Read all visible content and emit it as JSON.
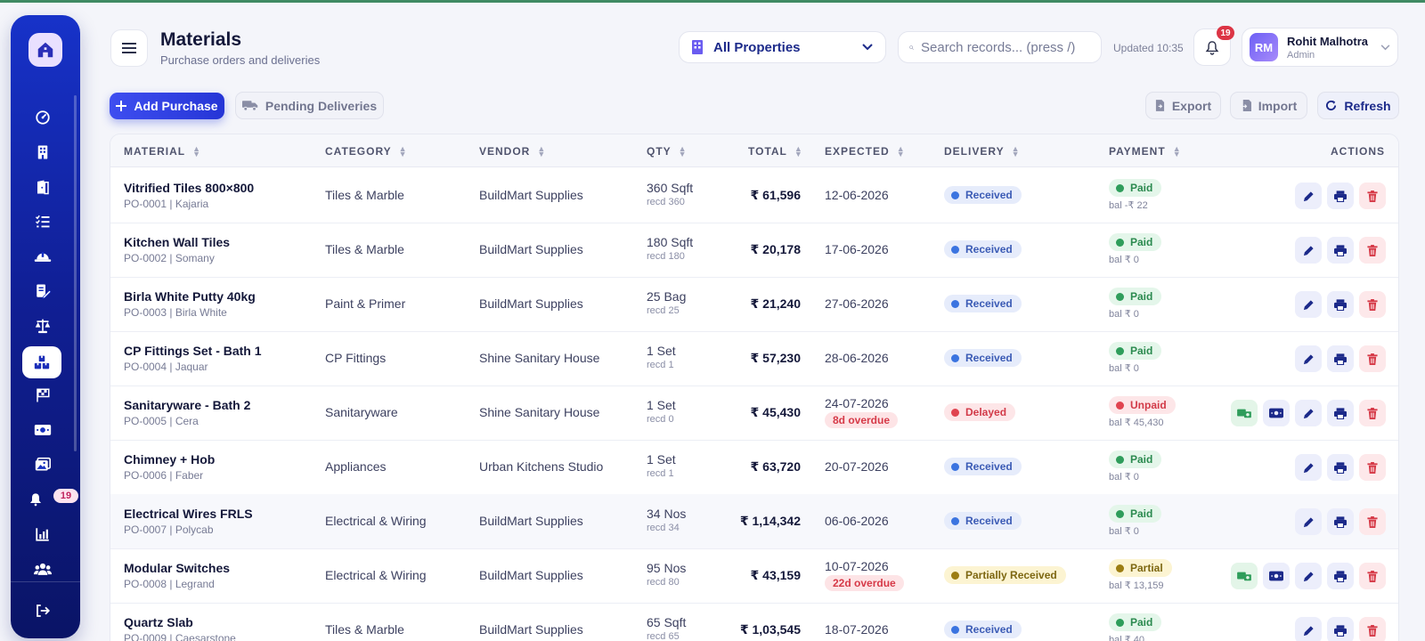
{
  "header": {
    "title": "Materials",
    "subtitle": "Purchase orders and deliveries",
    "property_select": "All Properties",
    "search_placeholder": "Search records... (press /)",
    "updated": "Updated 10:35",
    "notification_count": "19",
    "user": {
      "initials": "RM",
      "name": "Rohit Malhotra",
      "role": "Admin"
    }
  },
  "sidebar": {
    "notification_badge": "19"
  },
  "toolbar": {
    "add_purchase": "Add Purchase",
    "pending_deliveries": "Pending Deliveries",
    "export": "Export",
    "import": "Import",
    "refresh": "Refresh"
  },
  "table": {
    "columns": {
      "material": "MATERIAL",
      "category": "CATEGORY",
      "vendor": "VENDOR",
      "qty": "QTY",
      "total": "TOTAL",
      "expected": "EXPECTED",
      "delivery": "DELIVERY",
      "payment": "PAYMENT",
      "actions": "ACTIONS"
    },
    "rows": [
      {
        "name": "Vitrified Tiles 800×800",
        "sub": "PO-0001 | Kajaria",
        "category": "Tiles & Marble",
        "vendor": "BuildMart Supplies",
        "qty": "360 Sqft",
        "recd": "recd 360",
        "total": "₹ 61,596",
        "expected": "12-06-2026",
        "overdue": "",
        "delivery": "Received",
        "delivery_status": "received",
        "payment": "Paid",
        "payment_status": "paid",
        "balance": "bal -₹ 22",
        "extra_actions": false
      },
      {
        "name": "Kitchen Wall Tiles",
        "sub": "PO-0002 | Somany",
        "category": "Tiles & Marble",
        "vendor": "BuildMart Supplies",
        "qty": "180 Sqft",
        "recd": "recd 180",
        "total": "₹ 20,178",
        "expected": "17-06-2026",
        "overdue": "",
        "delivery": "Received",
        "delivery_status": "received",
        "payment": "Paid",
        "payment_status": "paid",
        "balance": "bal ₹ 0",
        "extra_actions": false
      },
      {
        "name": "Birla White Putty 40kg",
        "sub": "PO-0003 | Birla White",
        "category": "Paint & Primer",
        "vendor": "BuildMart Supplies",
        "qty": "25 Bag",
        "recd": "recd 25",
        "total": "₹ 21,240",
        "expected": "27-06-2026",
        "overdue": "",
        "delivery": "Received",
        "delivery_status": "received",
        "payment": "Paid",
        "payment_status": "paid",
        "balance": "bal ₹ 0",
        "extra_actions": false
      },
      {
        "name": "CP Fittings Set - Bath 1",
        "sub": "PO-0004 | Jaquar",
        "category": "CP Fittings",
        "vendor": "Shine Sanitary House",
        "qty": "1 Set",
        "recd": "recd 1",
        "total": "₹ 57,230",
        "expected": "28-06-2026",
        "overdue": "",
        "delivery": "Received",
        "delivery_status": "received",
        "payment": "Paid",
        "payment_status": "paid",
        "balance": "bal ₹ 0",
        "extra_actions": false
      },
      {
        "name": "Sanitaryware - Bath 2",
        "sub": "PO-0005 | Cera",
        "category": "Sanitaryware",
        "vendor": "Shine Sanitary House",
        "qty": "1 Set",
        "recd": "recd 0",
        "total": "₹ 45,430",
        "expected": "24-07-2026",
        "overdue": "8d overdue",
        "delivery": "Delayed",
        "delivery_status": "delayed",
        "payment": "Unpaid",
        "payment_status": "unpaid",
        "balance": "bal ₹ 45,430",
        "extra_actions": true
      },
      {
        "name": "Chimney + Hob",
        "sub": "PO-0006 | Faber",
        "category": "Appliances",
        "vendor": "Urban Kitchens Studio",
        "qty": "1 Set",
        "recd": "recd 1",
        "total": "₹ 63,720",
        "expected": "20-07-2026",
        "overdue": "",
        "delivery": "Received",
        "delivery_status": "received",
        "payment": "Paid",
        "payment_status": "paid",
        "balance": "bal ₹ 0",
        "extra_actions": false
      },
      {
        "name": "Electrical Wires FRLS",
        "sub": "PO-0007 | Polycab",
        "category": "Electrical & Wiring",
        "vendor": "BuildMart Supplies",
        "qty": "34 Nos",
        "recd": "recd 34",
        "total": "₹ 1,14,342",
        "expected": "06-06-2026",
        "overdue": "",
        "delivery": "Received",
        "delivery_status": "received",
        "payment": "Paid",
        "payment_status": "paid",
        "balance": "bal ₹ 0",
        "extra_actions": false
      },
      {
        "name": "Modular Switches",
        "sub": "PO-0008 | Legrand",
        "category": "Electrical & Wiring",
        "vendor": "BuildMart Supplies",
        "qty": "95 Nos",
        "recd": "recd 80",
        "total": "₹ 43,159",
        "expected": "10-07-2026",
        "overdue": "22d overdue",
        "delivery": "Partially Received",
        "delivery_status": "partial",
        "payment": "Partial",
        "payment_status": "ppartial",
        "balance": "bal ₹ 13,159",
        "extra_actions": true
      },
      {
        "name": "Quartz Slab",
        "sub": "PO-0009 | Caesarstone",
        "category": "Tiles & Marble",
        "vendor": "BuildMart Supplies",
        "qty": "65 Sqft",
        "recd": "recd 65",
        "total": "₹ 1,03,545",
        "expected": "18-07-2026",
        "overdue": "",
        "delivery": "Received",
        "delivery_status": "received",
        "payment": "Paid",
        "payment_status": "paid",
        "balance": "bal ₹ 40",
        "extra_actions": false
      }
    ]
  }
}
